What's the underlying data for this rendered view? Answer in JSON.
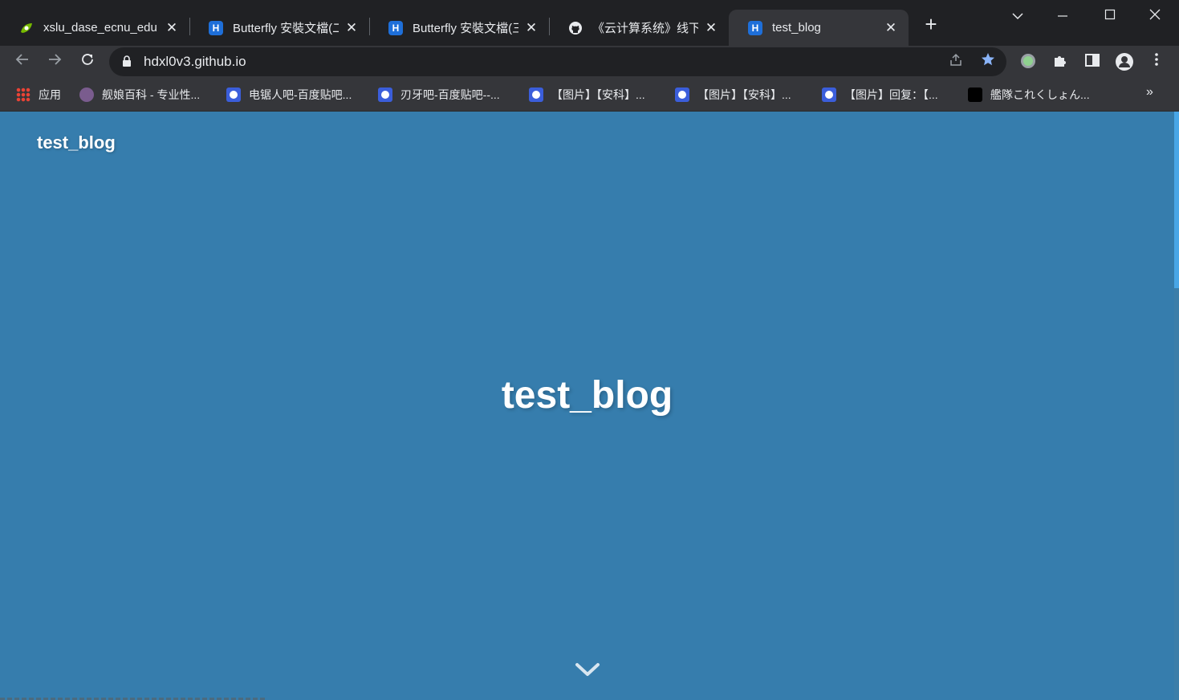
{
  "tabs": [
    {
      "title": "xslu_dase_ecnu_edu",
      "favicon": "leaf-icon"
    },
    {
      "title": "Butterfly 安裝文檔(二",
      "favicon": "hexo-icon"
    },
    {
      "title": "Butterfly 安裝文檔(三",
      "favicon": "hexo-icon"
    },
    {
      "title": "《云计算系统》线下班",
      "favicon": "github-icon"
    },
    {
      "title": "test_blog",
      "favicon": "hexo-icon",
      "active": true
    }
  ],
  "address_bar": {
    "url": "hdxl0v3.github.io"
  },
  "bookmarks": [
    {
      "label": "应用",
      "icon": "apps-grid-icon"
    },
    {
      "label": "舰娘百科 - 专业性...",
      "icon": "avatar-icon"
    },
    {
      "label": "电锯人吧-百度贴吧...",
      "icon": "baidu-icon"
    },
    {
      "label": "刃牙吧-百度贴吧--...",
      "icon": "baidu-icon"
    },
    {
      "label": "【图片】【安科】...",
      "icon": "baidu-icon"
    },
    {
      "label": "【图片】【安科】...",
      "icon": "baidu-icon"
    },
    {
      "label": "【图片】回复：【...",
      "icon": "baidu-icon"
    },
    {
      "label": "艦隊これくしょん...",
      "icon": "dmm-icon"
    }
  ],
  "page": {
    "brand": "test_blog",
    "site_title": "test_blog",
    "background_color": "#367dad"
  },
  "colors": {
    "tab_strip": "#202124",
    "toolbar": "#35363a",
    "star_accent": "#8ab4f8",
    "page_bg": "#367dad",
    "scroll_thumb": "#49a6e6"
  }
}
